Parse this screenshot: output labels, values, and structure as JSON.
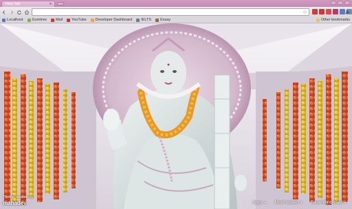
{
  "tab": {
    "title": "New Tab"
  },
  "toolbar": {
    "omnibox_value": ""
  },
  "bookmarks": [
    {
      "label": "Localhost",
      "icon_color": "#4a7fd0"
    },
    {
      "label": "Gumtree",
      "icon_color": "#7ab648"
    },
    {
      "label": "Mail",
      "icon_color": "#d4392f"
    },
    {
      "label": "YouTube",
      "icon_color": "#e52d27"
    },
    {
      "label": "Developer Dashboard",
      "icon_color": "#f2a33a"
    },
    {
      "label": "IELTS",
      "icon_color": "#6b7d8c"
    },
    {
      "label": "Essay",
      "icon_color": "#8b6c4a"
    }
  ],
  "other_bookmarks": {
    "label": "Other bookmarks",
    "icon_color": "#e8c45a"
  },
  "extensions": [
    "#d13b3b",
    "#c83a3a",
    "#e04848",
    "#b33d6a",
    "#5a7fc0",
    "#6d8fb5"
  ],
  "theme": {
    "credit_label": "Theme created by",
    "credit_name": "mahadev"
  },
  "footer": {
    "apps": "Apps",
    "most_visited": "Most visited",
    "recently_closed": "Recently closed"
  }
}
